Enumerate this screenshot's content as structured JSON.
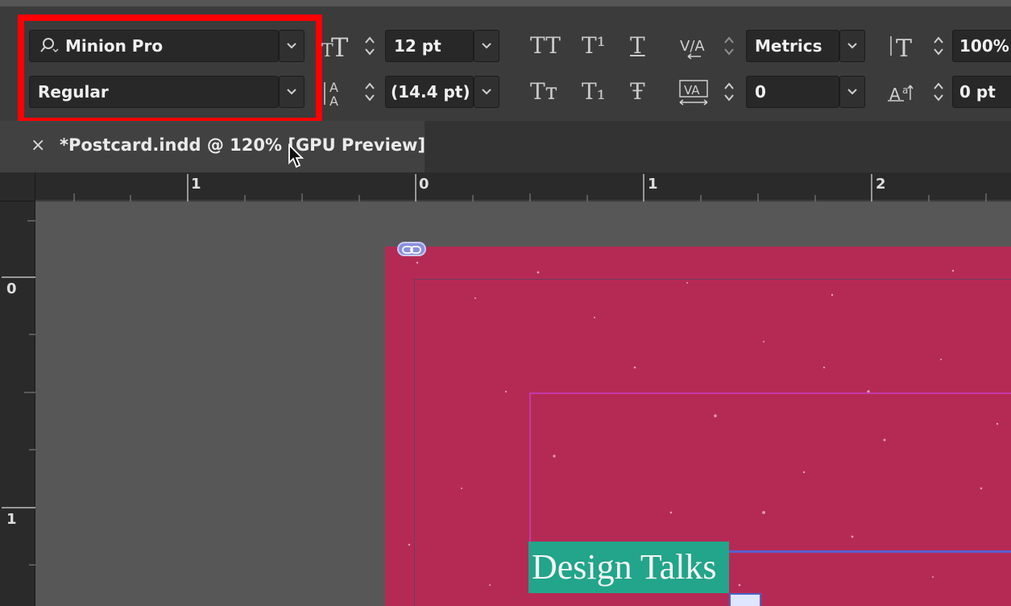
{
  "control_panel": {
    "font_family": "Minion Pro",
    "font_style": "Regular",
    "font_size": "12 pt",
    "leading": "(14.4 pt)",
    "kerning": "Metrics",
    "tracking": "0",
    "vertical_scale": "100%",
    "baseline_shift": "0 pt",
    "glyphs": {
      "all_caps": "TT",
      "superscript": "T¹",
      "underline": "T",
      "small_caps": "Tт",
      "subscript": "T₁",
      "strikethrough": "Ŧ"
    },
    "highlight_color": "#ff0000"
  },
  "document_tab": {
    "close_glyph": "×",
    "title": "*Postcard.indd @ 120% [GPU Preview]"
  },
  "rulers": {
    "horizontal": [
      "1",
      "0",
      "1",
      "2"
    ],
    "vertical": [
      "0",
      "1"
    ]
  },
  "canvas": {
    "selected_text": "Design Talks",
    "page_color": "#b52a55",
    "text_highlight_color": "#22a58a"
  }
}
